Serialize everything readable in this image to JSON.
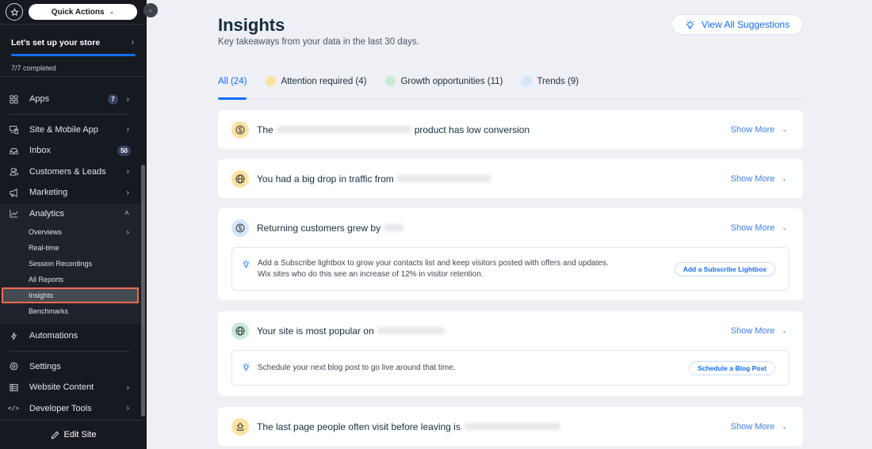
{
  "sidebar": {
    "quick_actions_label": "Quick Actions",
    "setup": {
      "title": "Let's set up your store",
      "progress_fraction": 1.0,
      "completed_text": "7/7 completed"
    },
    "items": {
      "apps": {
        "label": "Apps",
        "badge": "7"
      },
      "site_mobile": {
        "label": "Site & Mobile App"
      },
      "inbox": {
        "label": "Inbox",
        "badge": "50"
      },
      "customers": {
        "label": "Customers & Leads"
      },
      "marketing": {
        "label": "Marketing"
      },
      "analytics": {
        "label": "Analytics",
        "subitems": [
          "Overviews",
          "Real-time",
          "Session Recordings",
          "All Reports",
          "Insights",
          "Benchmarks"
        ]
      },
      "automations": {
        "label": "Automations"
      },
      "settings": {
        "label": "Settings"
      },
      "website_content": {
        "label": "Website Content"
      },
      "developer_tools": {
        "label": "Developer Tools"
      }
    },
    "edit_site_label": "Edit Site"
  },
  "header": {
    "title": "Insights",
    "subtitle": "Key takeaways from your data in the last 30 days.",
    "view_all_label": "View All Suggestions"
  },
  "tabs": [
    {
      "label": "All (24)",
      "active": true,
      "dot_color": null
    },
    {
      "label": "Attention required (4)",
      "active": false,
      "dot_color": "#fde2a3"
    },
    {
      "label": "Growth opportunities (11)",
      "active": false,
      "dot_color": "#c8ebd6"
    },
    {
      "label": "Trends (9)",
      "active": false,
      "dot_color": "#d6e6fe"
    }
  ],
  "colors": {
    "accent": "#116dff",
    "attention": "#fde2a3",
    "growth": "#c8ebd6",
    "trend": "#d6e6fe",
    "highlight_outline": "#f26b4c"
  },
  "insights": [
    {
      "category": "attention",
      "icon": "dollar-icon",
      "prefix": "The",
      "suffix": "product has low conversion",
      "show_more": "Show More"
    },
    {
      "category": "attention",
      "icon": "globe-icon",
      "prefix": "You had a big drop in traffic from",
      "suffix": "",
      "show_more": "Show More"
    },
    {
      "category": "trend",
      "icon": "dollar-icon",
      "prefix": "Returning customers grew by",
      "suffix": "",
      "show_more": "Show More",
      "suggestion": {
        "text": "Add a Subscribe lightbox to grow your contacts list and keep visitors posted with offers and updates. Wix sites who do this see an increase of 12% in visitor retention.",
        "button": "Add a Subscribe Lightbox"
      }
    },
    {
      "category": "growth",
      "icon": "globe-icon",
      "prefix": "Your site is most popular on",
      "suffix": "",
      "show_more": "Show More",
      "suggestion": {
        "text": "Schedule your next blog post to go live around that time.",
        "button": "Schedule a Blog Post"
      }
    },
    {
      "category": "attention",
      "icon": "exit-icon",
      "prefix": "The last page people often visit before leaving is",
      "suffix": "",
      "show_more": "Show More"
    }
  ]
}
